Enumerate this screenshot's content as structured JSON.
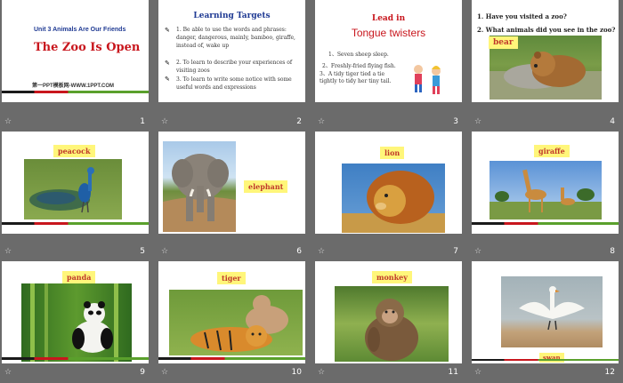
{
  "slides": [
    {
      "num": "1",
      "unit": "Unit 3 Animals Are Our Friends",
      "title": "The Zoo Is Open",
      "footer": "第一PPT模板网-WWW.1PPT.COM"
    },
    {
      "num": "2",
      "heading": "Learning Targets",
      "items": [
        "1. Be able to use the words and phrases: danger, dangerous, mainly, bamboo, giraffe, instead of, wake up",
        "2. To learn to describe your experiences of visiting zoos",
        "3. To learn to write some notice with some useful words and expressions"
      ]
    },
    {
      "num": "3",
      "heading": "Lead in",
      "subheading": "Tongue twisters",
      "lines": [
        "1、Seven sheep sleep.",
        "2、Freshly-fried flying fish.",
        "3、A tidy tiger tied a tie tightly to tidy her tiny tail."
      ]
    },
    {
      "num": "4",
      "questions": [
        "1. Have you visited a zoo?",
        "2. What animals did you see in the zoo?"
      ],
      "label": "bear"
    },
    {
      "num": "5",
      "label": "peacock"
    },
    {
      "num": "6",
      "label": "elephant"
    },
    {
      "num": "7",
      "label": "lion"
    },
    {
      "num": "8",
      "label": "giraffe"
    },
    {
      "num": "9",
      "label": "panda"
    },
    {
      "num": "10",
      "label": "tiger"
    },
    {
      "num": "11",
      "label": "monkey"
    },
    {
      "num": "12",
      "label": "swan"
    }
  ],
  "icons": {
    "slide_star": "star-icon",
    "bullet": "pencil-bullet-icon"
  },
  "colors": {
    "background": "#6b6b6b",
    "label_bg": "#fff67a",
    "label_text": "#c0392b",
    "heading": "#1f3a93",
    "accent_red": "#c8161d",
    "accent_green": "#5aa02c"
  }
}
